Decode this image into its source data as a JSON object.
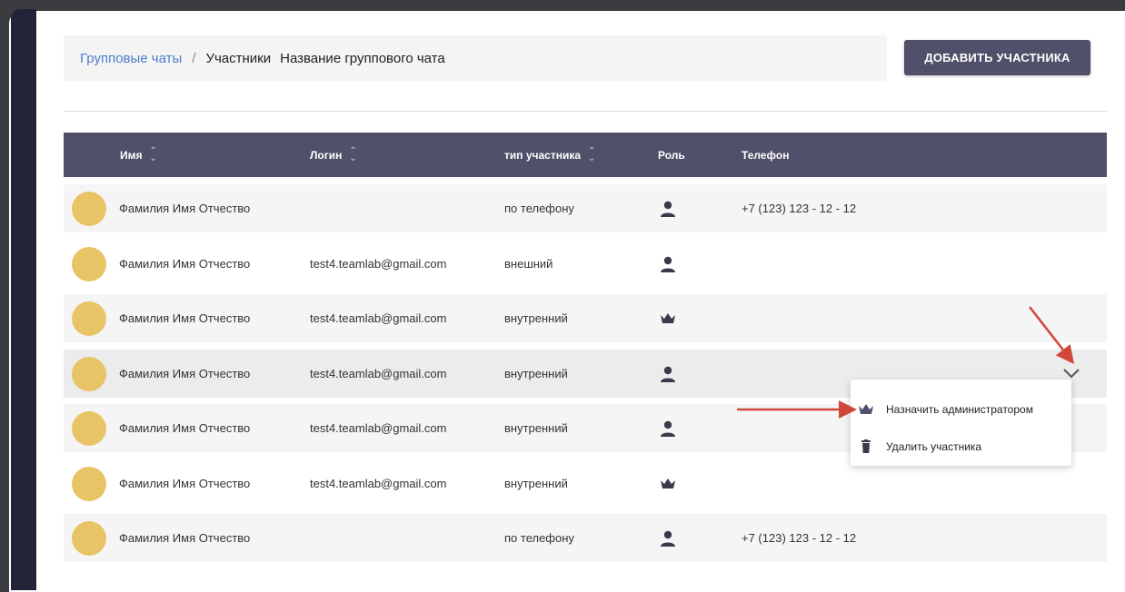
{
  "breadcrumb": {
    "link": "Групповые чаты",
    "separator": "/",
    "current": "Участники",
    "chat_name": "Название группового чата"
  },
  "actions": {
    "add_member_label": "ДОБАВИТЬ УЧАСТНИКА"
  },
  "table": {
    "headers": {
      "name": "Имя",
      "login": "Логин",
      "type": "тип участника",
      "role": "Роль",
      "phone": "Телефон"
    },
    "rows": [
      {
        "name": "Фамилия Имя Отчество",
        "login": "",
        "type": "по телефону",
        "role_icon": "user-icon",
        "phone": "+7 (123) 123 - 12 - 12"
      },
      {
        "name": "Фамилия Имя Отчество",
        "login": "test4.teamlab@gmail.com",
        "type": "внешний",
        "role_icon": "user-icon",
        "phone": ""
      },
      {
        "name": "Фамилия Имя Отчество",
        "login": "test4.teamlab@gmail.com",
        "type": "внутренний",
        "role_icon": "crown-icon",
        "phone": ""
      },
      {
        "name": "Фамилия Имя Отчество",
        "login": "test4.teamlab@gmail.com",
        "type": "внутренний",
        "role_icon": "user-icon",
        "phone": ""
      },
      {
        "name": "Фамилия Имя Отчество",
        "login": "test4.teamlab@gmail.com",
        "type": "внутренний",
        "role_icon": "user-icon",
        "phone": ""
      },
      {
        "name": "Фамилия Имя Отчество",
        "login": "test4.teamlab@gmail.com",
        "type": "внутренний",
        "role_icon": "crown-icon",
        "phone": ""
      },
      {
        "name": "Фамилия Имя Отчество",
        "login": "",
        "type": "по телефону",
        "role_icon": "user-icon",
        "phone": "+7 (123) 123 - 12 - 12"
      }
    ]
  },
  "row_menu": {
    "items": [
      {
        "label": "Назначить администратором",
        "icon": "crown-icon"
      },
      {
        "label": "Удалить участника",
        "icon": "trash-icon"
      }
    ]
  },
  "colors": {
    "header_bg": "#50506a",
    "button_bg": "#50506a",
    "link": "#4a7fc8",
    "avatar": "#e8c466",
    "annotation_arrow": "#d0463a",
    "sidebar": "#23233a"
  }
}
